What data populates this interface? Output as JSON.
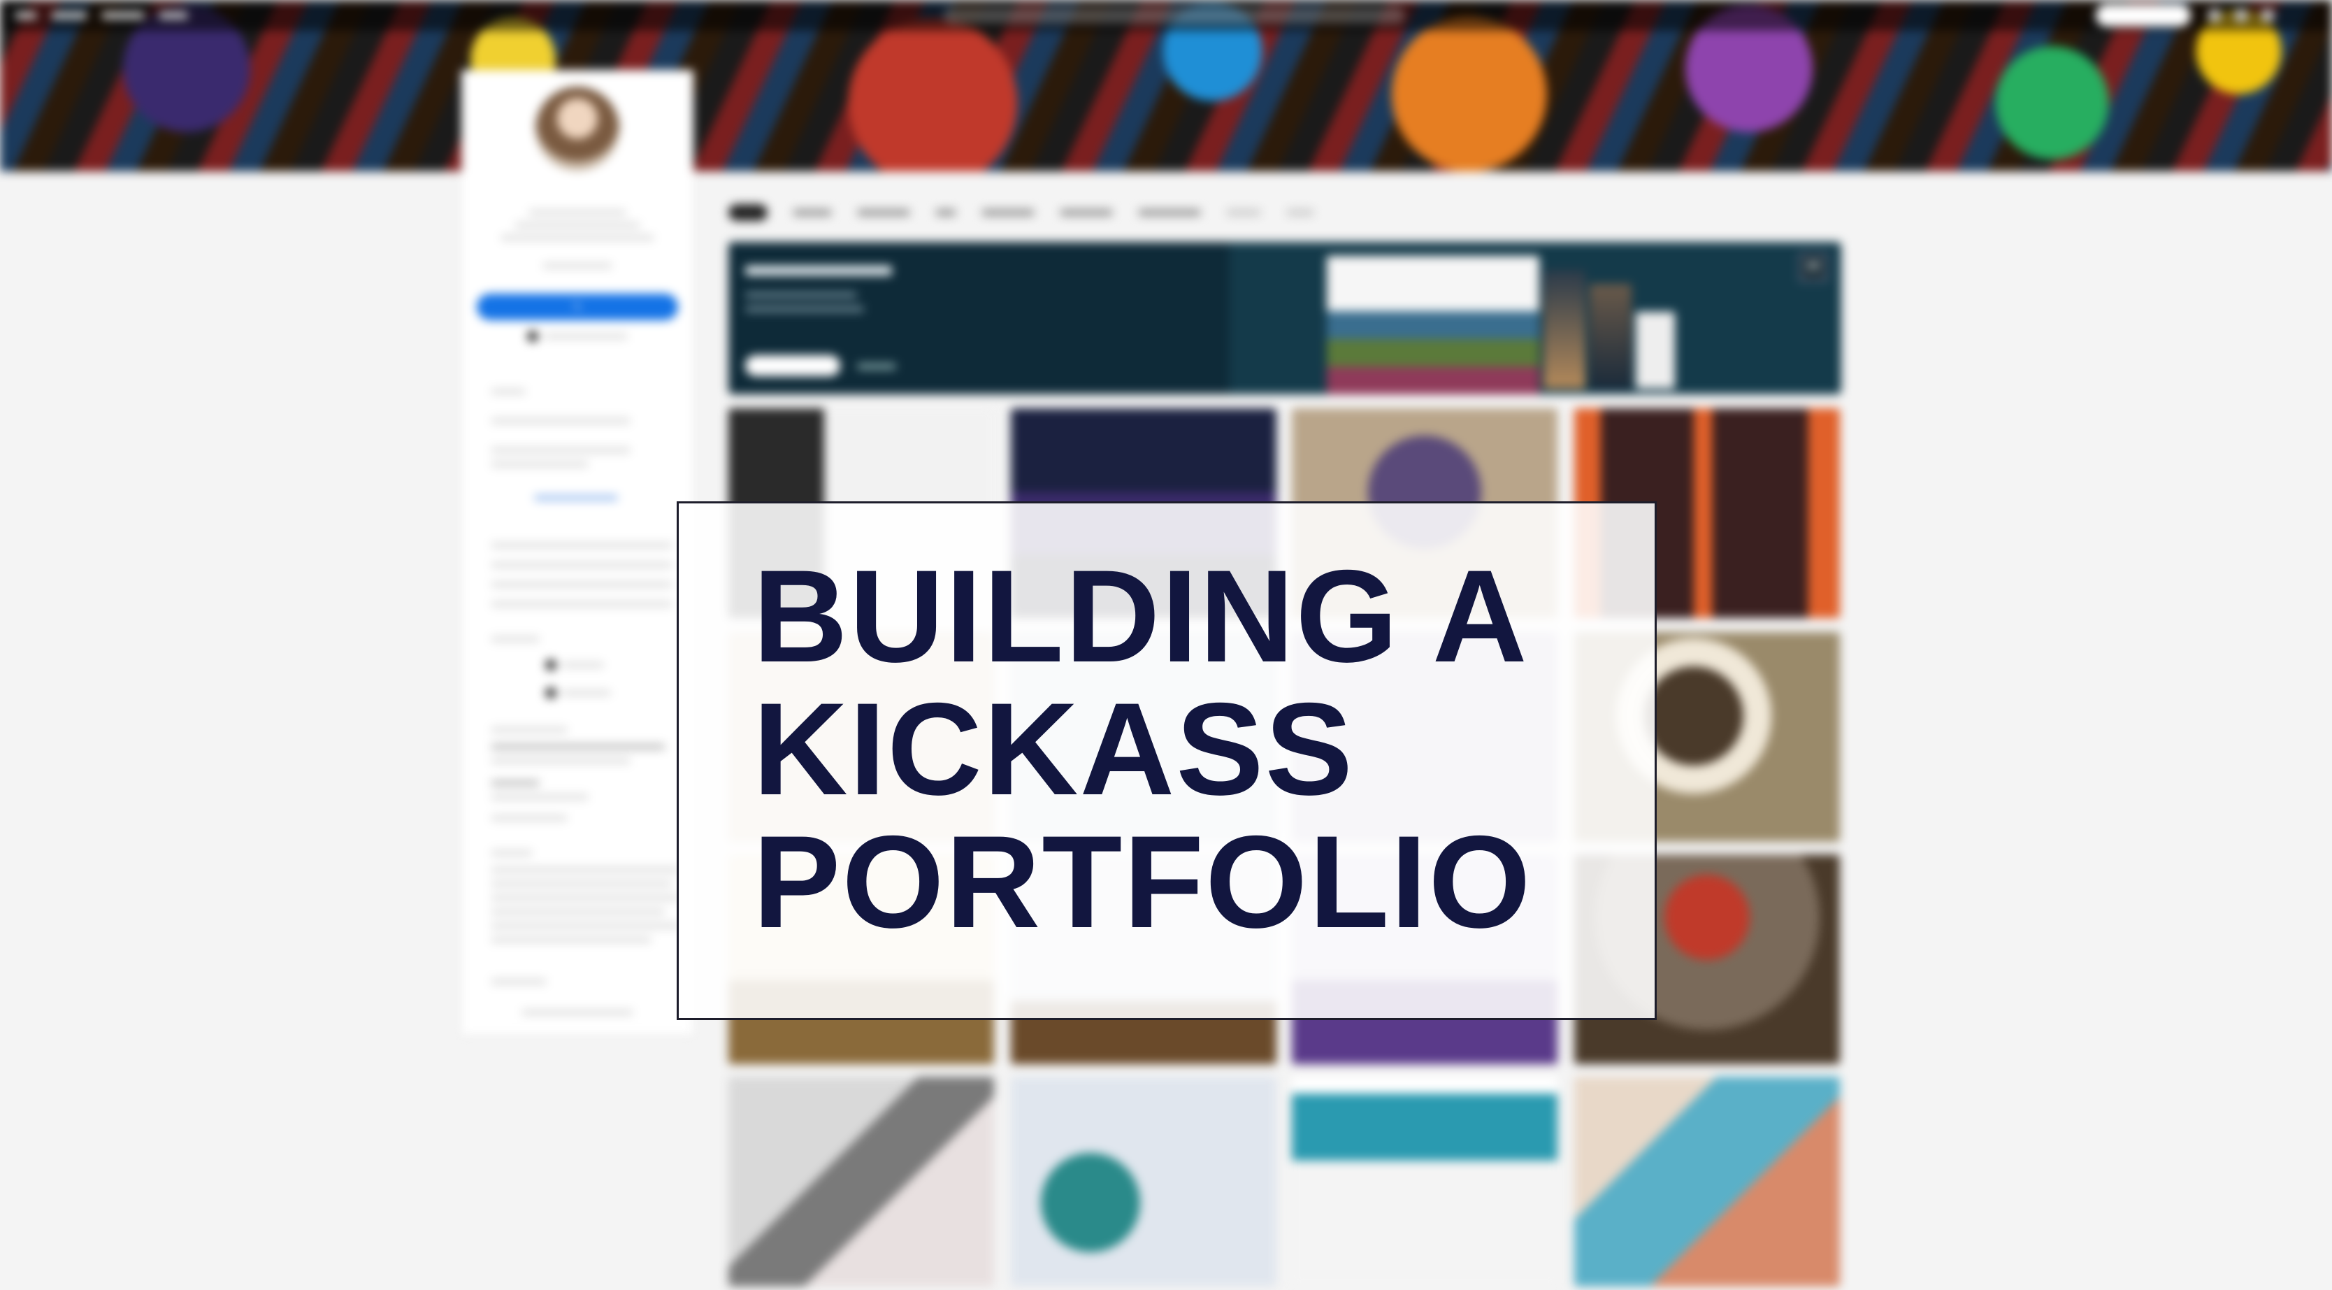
{
  "title_card": {
    "lines": [
      "BUILDING A",
      "KICKASS",
      "PORTFOLIO"
    ]
  },
  "colors": {
    "title_text": "#12163f",
    "accent_blue": "#1473e6",
    "promo_bg": "#0e2a38"
  },
  "icons": [
    "pencil-icon",
    "portfolio-icon"
  ]
}
